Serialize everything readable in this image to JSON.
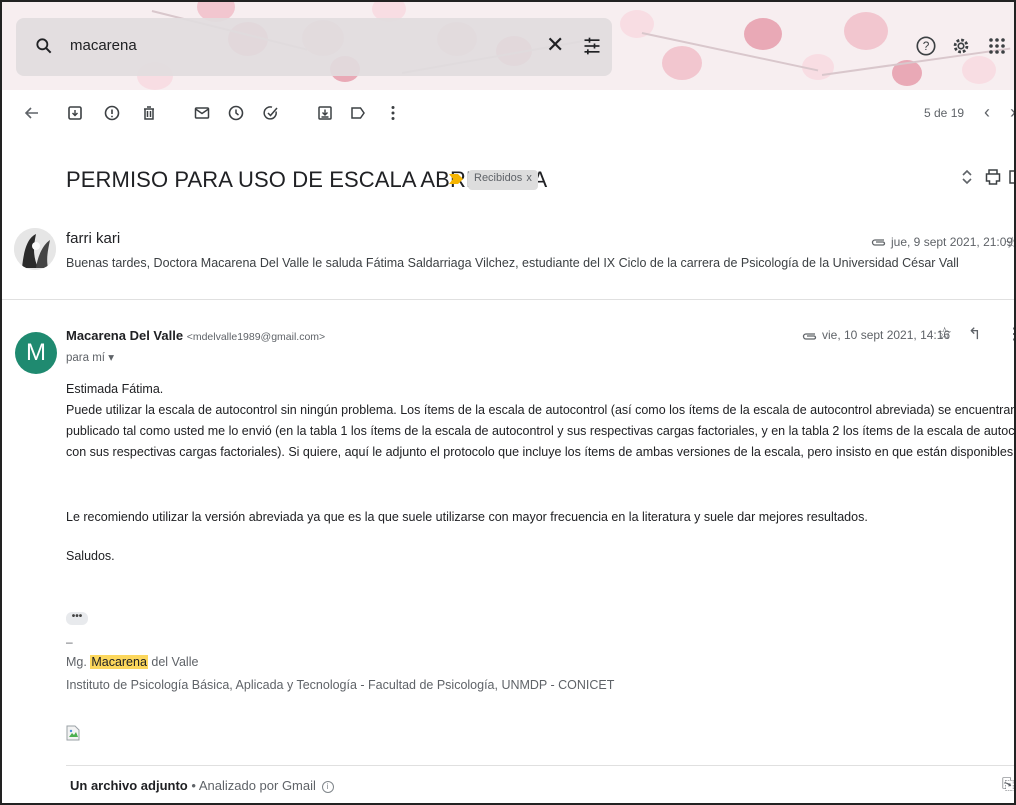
{
  "search": {
    "query": "macarena",
    "icons": [
      "search-icon",
      "clear-icon",
      "tune-icon",
      "help-icon",
      "settings-icon",
      "apps-icon"
    ]
  },
  "toolbar": {
    "icons": [
      "back-icon",
      "archive-icon",
      "spam-icon",
      "delete-icon",
      "mark-unread-icon",
      "snooze-icon",
      "add-task-icon",
      "move-to-icon",
      "label-icon",
      "more-icon"
    ],
    "pager": "5 de 19"
  },
  "thread": {
    "subject": "PERMISO PARA USO DE ESCALA ABREVIADA",
    "label": "Recibidos",
    "label_close": "x"
  },
  "messages": [
    {
      "sender": "farri kari",
      "snippet": "Buenas tardes, Doctora Macarena Del Valle le saluda Fátima Saldarriaga Vilchez, estudiante del IX Ciclo de la carrera de Psicología de la Universidad César Vall",
      "date": "jue, 9 sept 2021, 21:09"
    },
    {
      "avatar_letter": "M",
      "avatar_color": "#1f8a70",
      "sender": "Macarena Del Valle",
      "email": "<mdelvalle1989@gmail.com>",
      "to": "para mí",
      "date": "vie, 10 sept 2021, 14:16",
      "body": {
        "greeting": "Estimada Fátima.",
        "p1_line1": "Puede utilizar la escala de autocontrol sin ningún problema. Los ítems de la escala de autocontrol (así como los ítems de la escala de autocontrol abreviada) se encuentran disponibles en el artículo",
        "p1_line2": "publicado tal como usted me lo envió (en la tabla 1 los ítems de la escala de autocontrol y sus respectivas cargas factoriales, y en la tabla 2 los ítems de la escala de autocontrol abreviada, también",
        "p1_line3": "con sus respectivas cargas factoriales). Si quiere, aquí le adjunto el protocolo que incluye los ítems de ambas versiones de la escala, pero insisto en que están disponibles en el artículo mismo.",
        "p2": "Le recomiendo utilizar la versión abreviada ya que es la que suele utilizarse con mayor frecuencia en la literatura y suele dar mejores resultados.",
        "closing": "Saludos.",
        "ellipsis": "•••",
        "dash": "–",
        "sig_prefix": "Mg.",
        "sig_highlight": "Macarena",
        "sig_suffix": "del Valle",
        "sig_institution": "Instituto de Psicología Básica, Aplicada y Tecnología - Facultad de Psicología, UNMDP - CONICET"
      }
    }
  ],
  "attachments": {
    "label": "Un archivo adjunto",
    "separator": "•",
    "scan": "Analizado por Gmail",
    "info": "i"
  }
}
